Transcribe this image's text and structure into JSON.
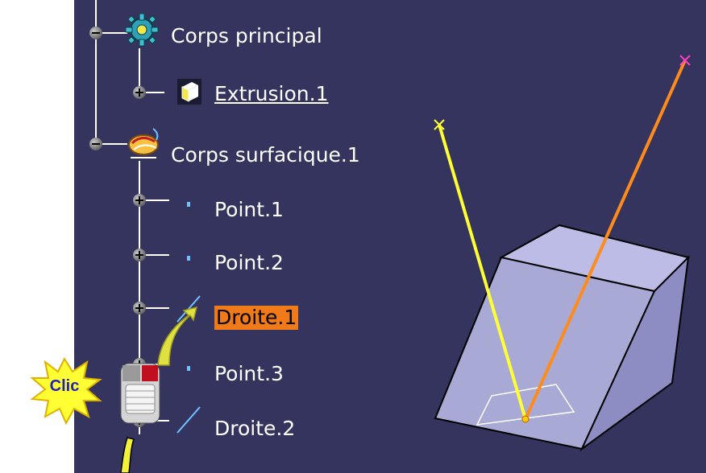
{
  "tree": {
    "items": [
      {
        "label": "Corps principal",
        "icon": "part-body-gear-icon"
      },
      {
        "label": "Extrusion.1",
        "icon": "extrude-icon"
      },
      {
        "label": "Corps surfacique.1",
        "icon": "geometrical-set-icon"
      },
      {
        "label": "Point.1",
        "icon": "point-icon"
      },
      {
        "label": "Point.2",
        "icon": "point-icon"
      },
      {
        "label": "Droite.1",
        "icon": "line-icon"
      },
      {
        "label": "Point.3",
        "icon": "point-icon"
      },
      {
        "label": "Droite.2",
        "icon": "line-icon"
      }
    ]
  },
  "callout": {
    "text": "Clic",
    "icon": "mouse-icon"
  },
  "colors": {
    "viewport_bg": "#34345f",
    "selection_highlight": "#f07a1a",
    "line1": "#ffff33",
    "line2": "#ff8c1a",
    "solid_face": "#a9a9d6",
    "point_icon": "#6fc3ff"
  }
}
